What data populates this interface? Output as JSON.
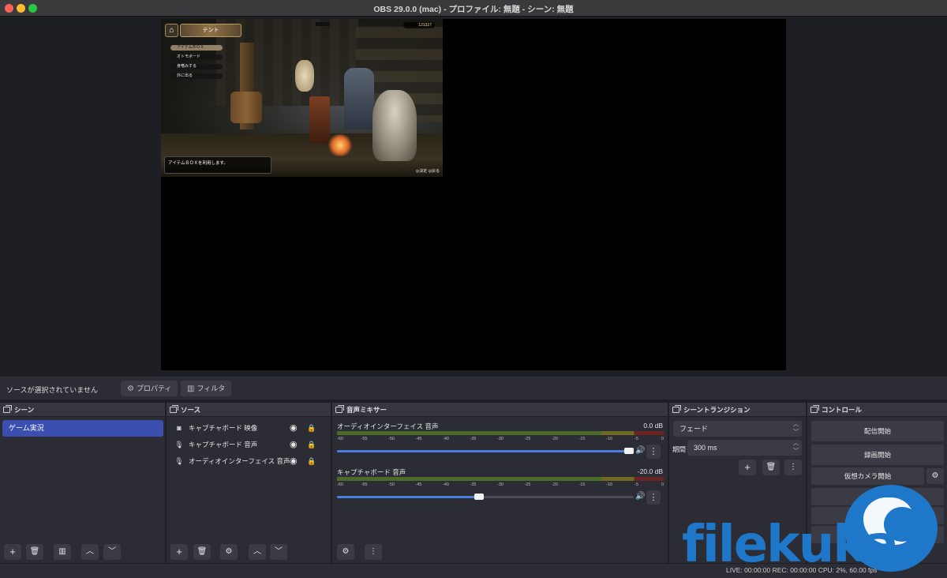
{
  "window": {
    "title": "OBS 29.0.0 (mac) - プロファイル: 無題 - シーン: 無題"
  },
  "game": {
    "tent_label": "テント",
    "menu": [
      "アイテムＢＯＸ",
      "オトモボード",
      "身嗜みする",
      "外に出る"
    ],
    "money": "121327",
    "message": "アイテムＢＯＸを利用します。",
    "controls": "◎決定 ◎戻る"
  },
  "context": {
    "no_source": "ソースが選択されていません",
    "properties": "プロパティ",
    "filters": "フィルタ"
  },
  "scenes": {
    "title": "シーン",
    "items": [
      "ゲーム実況"
    ]
  },
  "sources": {
    "title": "ソース",
    "items": [
      {
        "label": "キャプチャボード 映像",
        "icon": "camera-icon"
      },
      {
        "label": "キャプチャボード 音声",
        "icon": "microphone-icon"
      },
      {
        "label": "オーディオインターフェイス 音声",
        "icon": "microphone-icon"
      }
    ]
  },
  "mixer": {
    "title": "音声ミキサー",
    "ticks": [
      "-60",
      "-55",
      "-50",
      "-45",
      "-40",
      "-35",
      "-30",
      "-25",
      "-20",
      "-15",
      "-10",
      "-5",
      "0"
    ],
    "channels": [
      {
        "name": "オーディオインターフェイス 音声",
        "db": "0.0 dB",
        "level": 0.0,
        "volume": 1.0
      },
      {
        "name": "キャプチャボード 音声",
        "db": "-20.0 dB",
        "level": 0.0,
        "volume": 0.48
      }
    ]
  },
  "transitions": {
    "title": "シーントランジション",
    "selected": "フェード",
    "period_label": "期間",
    "period_value": "300 ms"
  },
  "controls": {
    "title": "コントロール",
    "start_streaming": "配信開始",
    "start_recording": "録画開始",
    "start_virtual_camera": "仮想カメラ開始",
    "studio_mode_partial": "ス",
    "settings": "設定",
    "exit": "終了"
  },
  "status": {
    "partial_text": "LIVE: 00:00:00  REC: 00:00:00  CPU: 2%, 60.00 fps"
  },
  "watermark": {
    "text": "filekuka"
  },
  "colors": {
    "accent": "#3a4fb0",
    "slider": "#4a7ee0",
    "watermark": "#1f77c9"
  }
}
